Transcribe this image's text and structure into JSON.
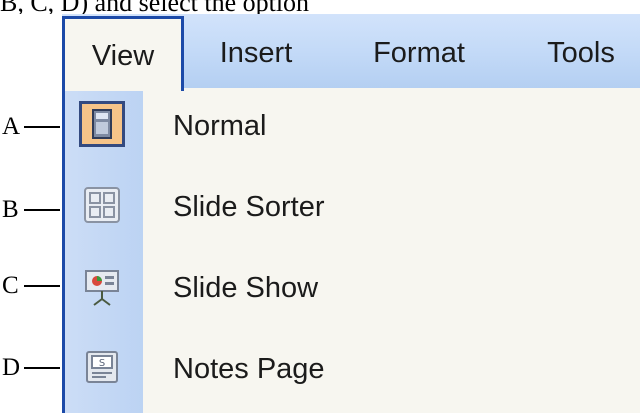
{
  "caption": "B, C, D) and select the option",
  "menubar": {
    "items": [
      {
        "label": "View",
        "active": true
      },
      {
        "label": "Insert",
        "active": false
      },
      {
        "label": "Format",
        "active": false
      },
      {
        "label": "Tools",
        "active": false
      }
    ]
  },
  "view_menu": {
    "items": [
      {
        "label": "Normal",
        "icon": "normal-view-icon",
        "selected": true
      },
      {
        "label": "Slide Sorter",
        "icon": "slide-sorter-icon",
        "selected": false
      },
      {
        "label": "Slide Show",
        "icon": "slide-show-icon",
        "selected": false
      },
      {
        "label": "Notes Page",
        "icon": "notes-page-icon",
        "selected": false
      }
    ]
  },
  "callouts": [
    "A",
    "B",
    "C",
    "D"
  ],
  "colors": {
    "menubar": "#c2d9f7",
    "menu_border": "#1c4aa8",
    "dropdown_bg": "#f7f6f0",
    "icon_gutter": "#c4d8f4",
    "selected_icon_bg": "#f6c489"
  }
}
